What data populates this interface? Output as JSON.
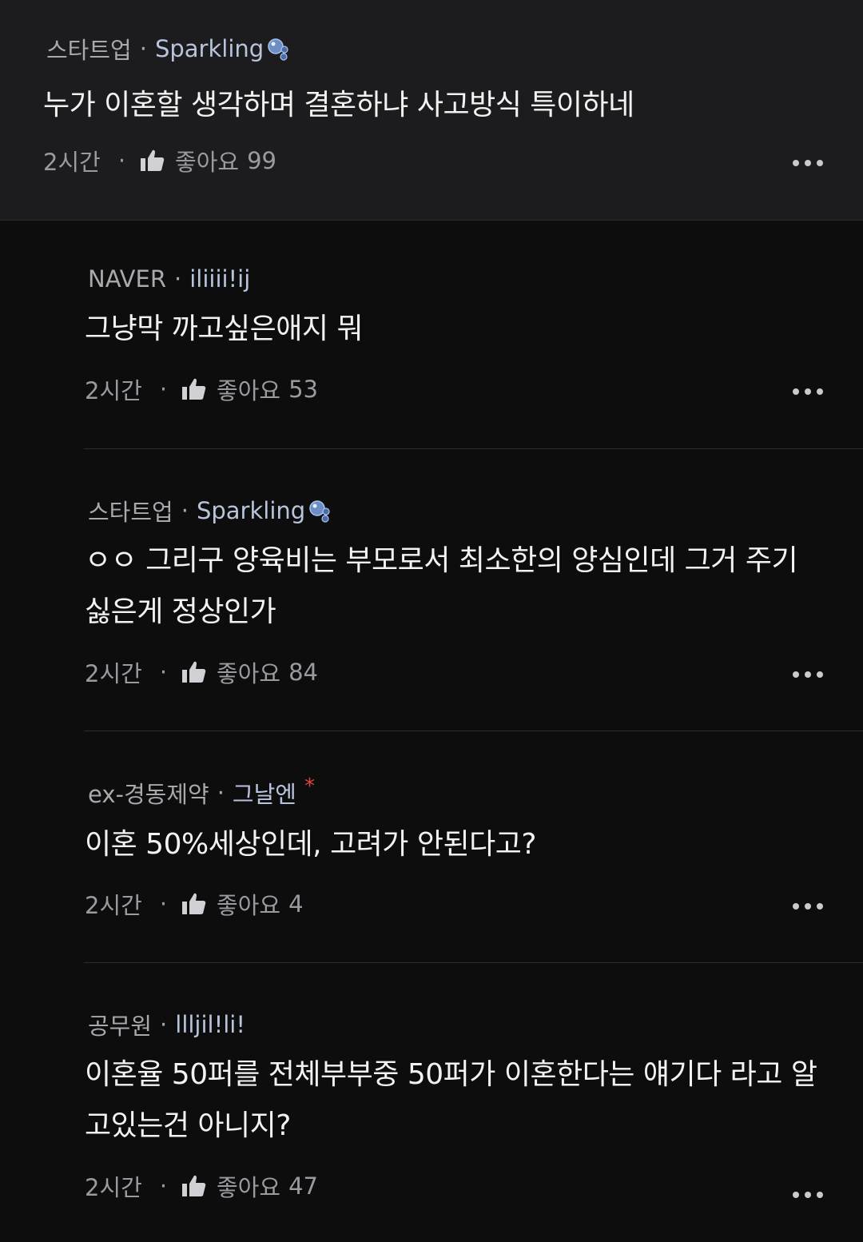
{
  "parent": {
    "company": "스타트업",
    "nickname": "Sparkling",
    "text": "누가 이혼할 생각하며 결혼하냐 사고방식 특이하네",
    "time": "2시간",
    "like_label": "좋아요",
    "like_count": "99"
  },
  "replies": [
    {
      "company": "NAVER",
      "nickname": "iliiii!ij",
      "text": "그냥막 까고싶은애지 뭐",
      "time": "2시간",
      "like_label": "좋아요",
      "like_count": "53"
    },
    {
      "company": "스타트업",
      "nickname": "Sparkling",
      "text": "ㅇㅇ 그리구 양육비는 부모로서 최소한의 양심인데 그거 주기 싫은게 정상인가",
      "time": "2시간",
      "like_label": "좋아요",
      "like_count": "84"
    },
    {
      "company": "ex-경동제약",
      "nickname": "그날엔",
      "star": "*",
      "text": "이혼 50%세상인데, 고려가 안된다고?",
      "time": "2시간",
      "like_label": "좋아요",
      "like_count": "4"
    },
    {
      "company": "공무원",
      "nickname": "llljil!li!",
      "text": "이혼율 50퍼를 전체부부중 50퍼가 이혼한다는 얘기다 라고 알고있는건 아니지?",
      "time": "2시간",
      "like_label": "좋아요",
      "like_count": "47"
    }
  ],
  "colors": {
    "background": "#0d0d0e",
    "parent_background": "#1c1c1e",
    "text": "#f2f2f2",
    "muted": "#9a9aa0",
    "star": "#e0443c"
  },
  "icons": {
    "like": "thumbs-up-icon",
    "more": "more-horizontal-icon",
    "badge": "bubbles-icon"
  }
}
